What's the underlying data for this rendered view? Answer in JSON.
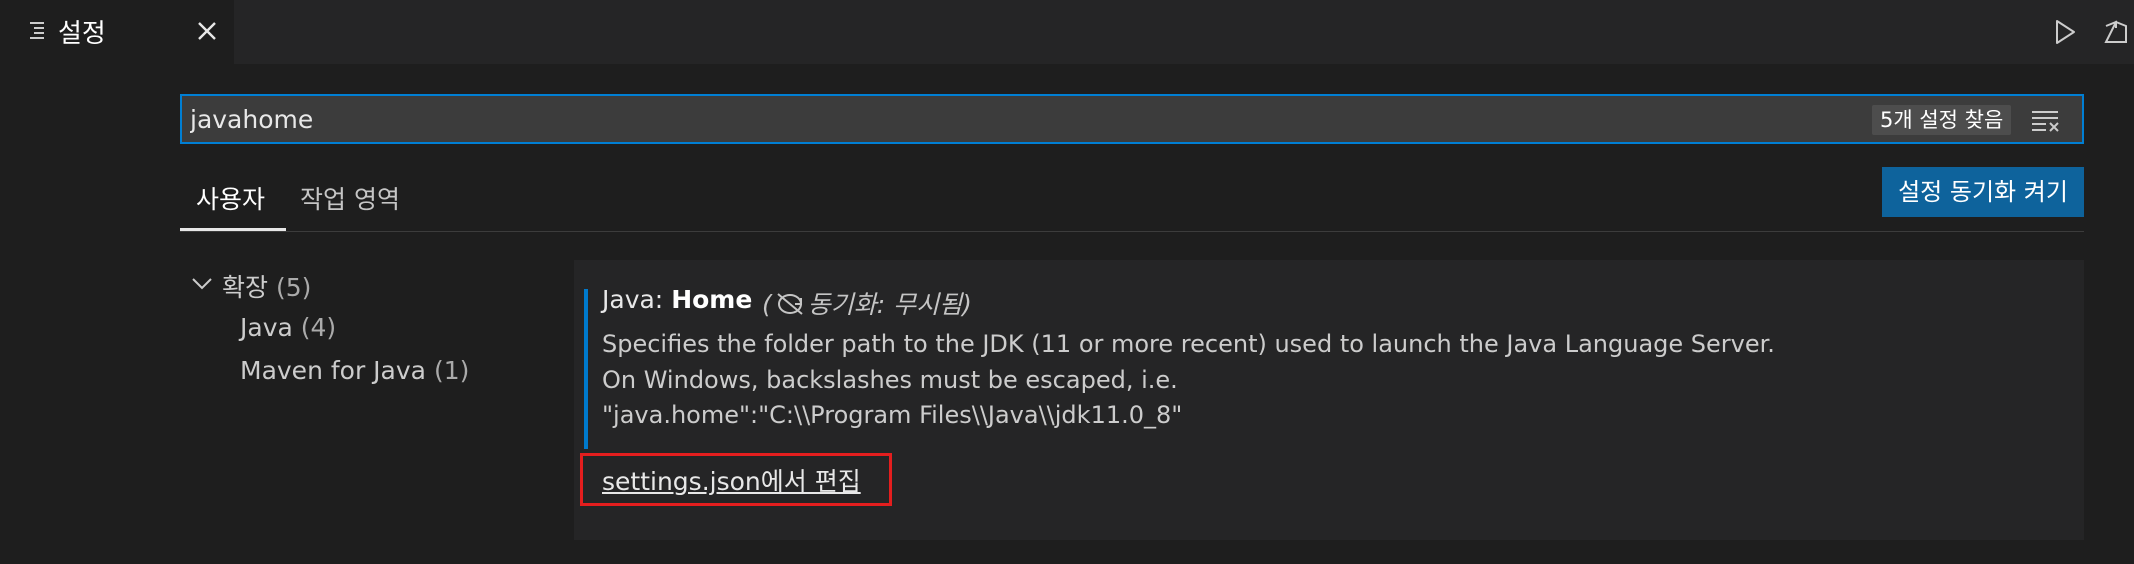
{
  "editor_tab": {
    "label": "설정"
  },
  "search": {
    "value": "javahome",
    "result_count": "5개 설정 찾음"
  },
  "scope_tabs": {
    "user": "사용자",
    "workspace": "작업 영역"
  },
  "sync_button": {
    "label": "설정 동기화 켜기"
  },
  "toc": {
    "group": {
      "label": "확장",
      "count": "(5)"
    },
    "items": [
      {
        "label": "Java",
        "count": "(4)"
      },
      {
        "label": "Maven for Java",
        "count": "(1)"
      }
    ]
  },
  "setting": {
    "category": "Java: ",
    "name": "Home",
    "sync_open": "(",
    "sync_label": "동기화: 무시됨)",
    "description": [
      "Specifies the folder path to the JDK (11 or more recent) used to launch the Java Language Server.",
      "On Windows, backslashes must be escaped, i.e.",
      "\"java.home\":\"C:\\\\Program Files\\\\Java\\\\jdk11.0_8\""
    ],
    "edit_link": "settings.json에서 편집"
  },
  "colors": {
    "accent": "#007fd4",
    "button": "#0e639c",
    "highlight": "#e41e1e"
  }
}
